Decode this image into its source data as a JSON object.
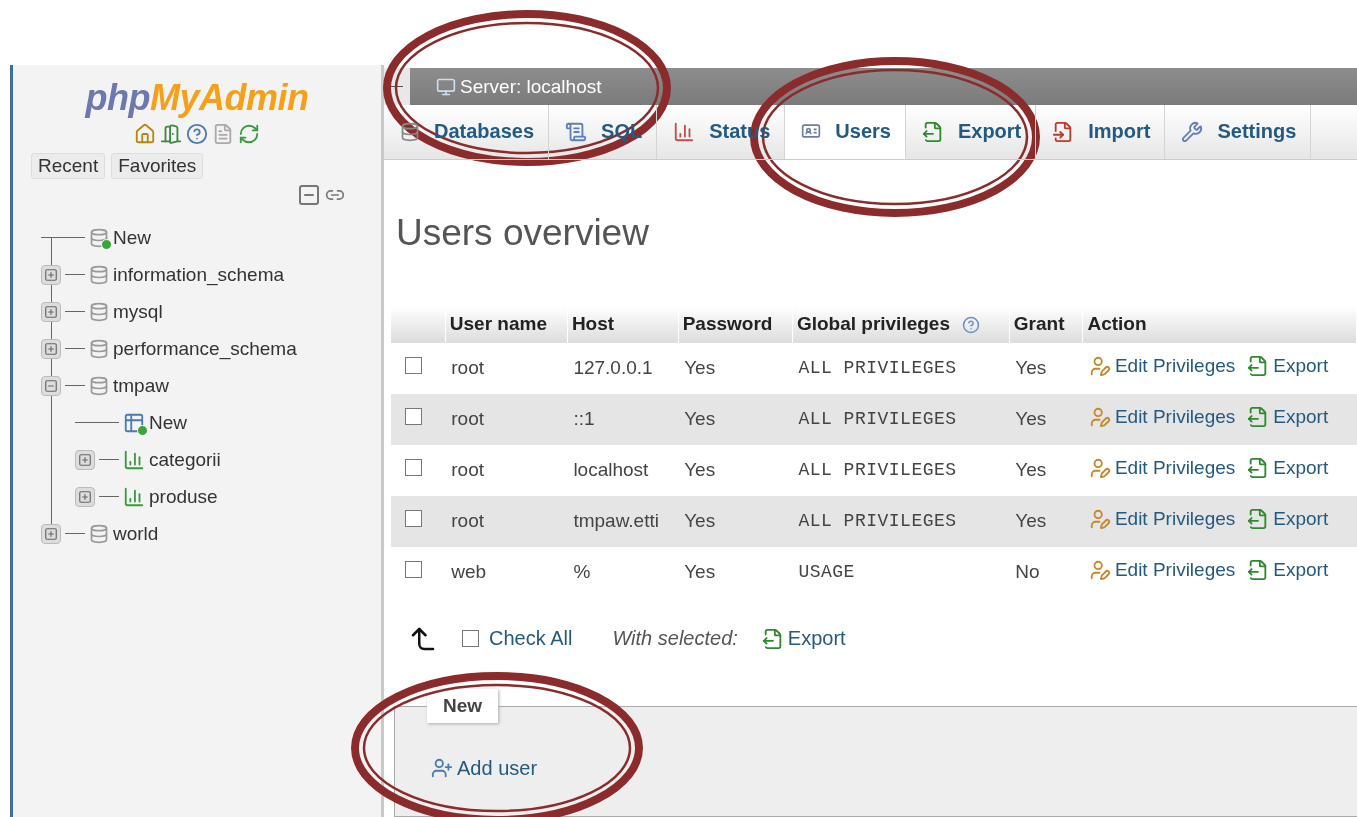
{
  "sidebar": {
    "logo": {
      "part_1": "php",
      "part_2": "MyAdmin"
    },
    "buttons": [
      {
        "label": "Recent"
      },
      {
        "label": "Favorites"
      }
    ],
    "tree": [
      {
        "label": "New",
        "kind": "new_database"
      },
      {
        "label": "information_schema",
        "kind": "database",
        "expanded": false
      },
      {
        "label": "mysql",
        "kind": "database",
        "expanded": false
      },
      {
        "label": "performance_schema",
        "kind": "database",
        "expanded": false
      },
      {
        "label": "tmpaw",
        "kind": "database",
        "expanded": true,
        "children": [
          {
            "label": "New",
            "kind": "new_table"
          },
          {
            "label": "categorii",
            "kind": "table",
            "expanded": false
          },
          {
            "label": "produse",
            "kind": "table",
            "expanded": false
          }
        ]
      },
      {
        "label": "world",
        "kind": "database",
        "expanded": false
      }
    ]
  },
  "breadcrumb": {
    "label": "Server: localhost"
  },
  "tabs": [
    {
      "label": "Databases",
      "selected": false
    },
    {
      "label": "SQL",
      "selected": false
    },
    {
      "label": "Status",
      "selected": false
    },
    {
      "label": "Users",
      "selected": true
    },
    {
      "label": "Export",
      "selected": false
    },
    {
      "label": "Import",
      "selected": false
    },
    {
      "label": "Settings",
      "selected": false
    }
  ],
  "heading": "Users overview",
  "table": {
    "columns": [
      "User name",
      "Host",
      "Password",
      "Global privileges",
      "Grant",
      "Action"
    ],
    "rows": [
      {
        "checked": false,
        "user": "root",
        "host": "127.0.0.1",
        "password": "Yes",
        "privileges": "ALL PRIVILEGES",
        "grant": "Yes",
        "edit": "Edit Privileges",
        "export": "Export"
      },
      {
        "checked": false,
        "user": "root",
        "host": "::1",
        "password": "Yes",
        "privileges": "ALL PRIVILEGES",
        "grant": "Yes",
        "edit": "Edit Privileges",
        "export": "Export"
      },
      {
        "checked": false,
        "user": "root",
        "host": "localhost",
        "password": "Yes",
        "privileges": "ALL PRIVILEGES",
        "grant": "Yes",
        "edit": "Edit Privileges",
        "export": "Export"
      },
      {
        "checked": false,
        "user": "root",
        "host": "tmpaw.etti",
        "password": "Yes",
        "privileges": "ALL PRIVILEGES",
        "grant": "Yes",
        "edit": "Edit Privileges",
        "export": "Export"
      },
      {
        "checked": false,
        "user": "web",
        "host": "%",
        "password": "Yes",
        "privileges": "USAGE",
        "grant": "No",
        "edit": "Edit Privileges",
        "export": "Export"
      }
    ]
  },
  "footer": {
    "check_all": {
      "label": "Check All",
      "checked": false
    },
    "with_selected": "With selected:",
    "export": "Export"
  },
  "new_section": {
    "legend": "New",
    "add_user": "Add user"
  }
}
